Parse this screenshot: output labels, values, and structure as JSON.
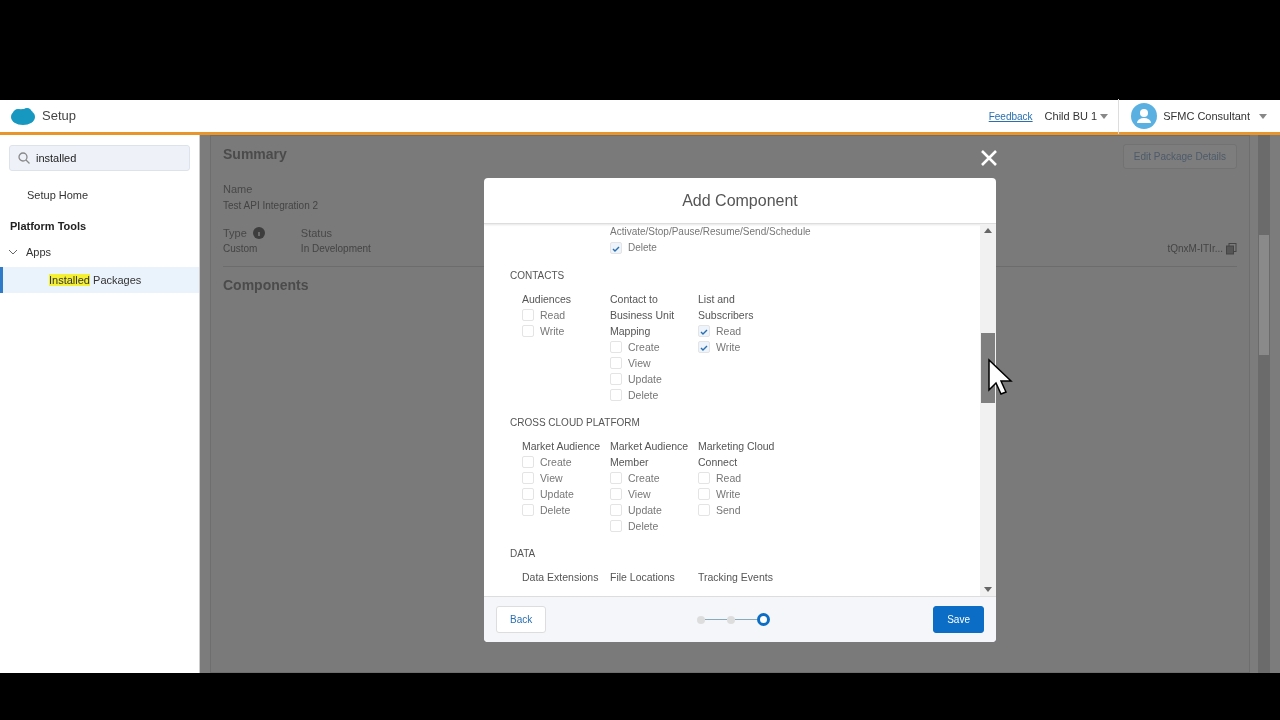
{
  "header": {
    "app_title": "Setup",
    "feedback": "Feedback",
    "business_unit": "Child BU 1",
    "user": "SFMC Consultant"
  },
  "sidebar": {
    "search": {
      "value": "installed"
    },
    "items": [
      {
        "label": "Setup Home"
      }
    ],
    "section": "Platform Tools",
    "tree": [
      {
        "label": "Apps",
        "expanded": true,
        "children": [
          {
            "match": "Installed",
            "rest": " Packages",
            "selected": true
          }
        ]
      }
    ]
  },
  "page": {
    "summary_title": "Summary",
    "edit_button": "Edit Package Details",
    "fields": [
      {
        "label": "Name",
        "value": "Test API Integration 2"
      }
    ],
    "field_row": [
      {
        "label": "Type",
        "value": "Custom",
        "info": true
      },
      {
        "label": "Status",
        "value": "In Development",
        "info": false
      }
    ],
    "id_fragment": "tQnxM-ITIr...",
    "components_title": "Components"
  },
  "modal": {
    "title": "Add Component",
    "top_fragment": {
      "heading": "Activate/Stop/Pause/Resume/Send/Schedule",
      "options": [
        {
          "label": "Delete",
          "checked": true
        }
      ]
    },
    "sections": [
      {
        "heading": "CONTACTS",
        "groups": [
          {
            "title": "Audiences",
            "options": [
              {
                "label": "Read",
                "checked": false
              },
              {
                "label": "Write",
                "checked": false
              }
            ]
          },
          {
            "title": "Contact to Business Unit Mapping",
            "options": [
              {
                "label": "Create",
                "checked": false
              },
              {
                "label": "View",
                "checked": false
              },
              {
                "label": "Update",
                "checked": false
              },
              {
                "label": "Delete",
                "checked": false
              }
            ]
          },
          {
            "title": "List and Subscribers",
            "options": [
              {
                "label": "Read",
                "checked": true
              },
              {
                "label": "Write",
                "checked": true
              }
            ]
          }
        ]
      },
      {
        "heading": "CROSS CLOUD PLATFORM",
        "groups": [
          {
            "title": "Market Audience",
            "options": [
              {
                "label": "Create",
                "checked": false
              },
              {
                "label": "View",
                "checked": false
              },
              {
                "label": "Update",
                "checked": false
              },
              {
                "label": "Delete",
                "checked": false
              }
            ]
          },
          {
            "title": "Market Audience Member",
            "options": [
              {
                "label": "Create",
                "checked": false
              },
              {
                "label": "View",
                "checked": false
              },
              {
                "label": "Update",
                "checked": false
              },
              {
                "label": "Delete",
                "checked": false
              }
            ]
          },
          {
            "title": "Marketing Cloud Connect",
            "options": [
              {
                "label": "Read",
                "checked": false
              },
              {
                "label": "Write",
                "checked": false
              },
              {
                "label": "Send",
                "checked": false
              }
            ]
          }
        ]
      },
      {
        "heading": "DATA",
        "groups": [
          {
            "title": "Data Extensions"
          },
          {
            "title": "File Locations"
          },
          {
            "title": "Tracking Events"
          }
        ]
      }
    ],
    "back": "Back",
    "steps": [
      {
        "selected": false
      },
      {
        "selected": false
      },
      {
        "selected": true
      }
    ],
    "save": "Save"
  }
}
